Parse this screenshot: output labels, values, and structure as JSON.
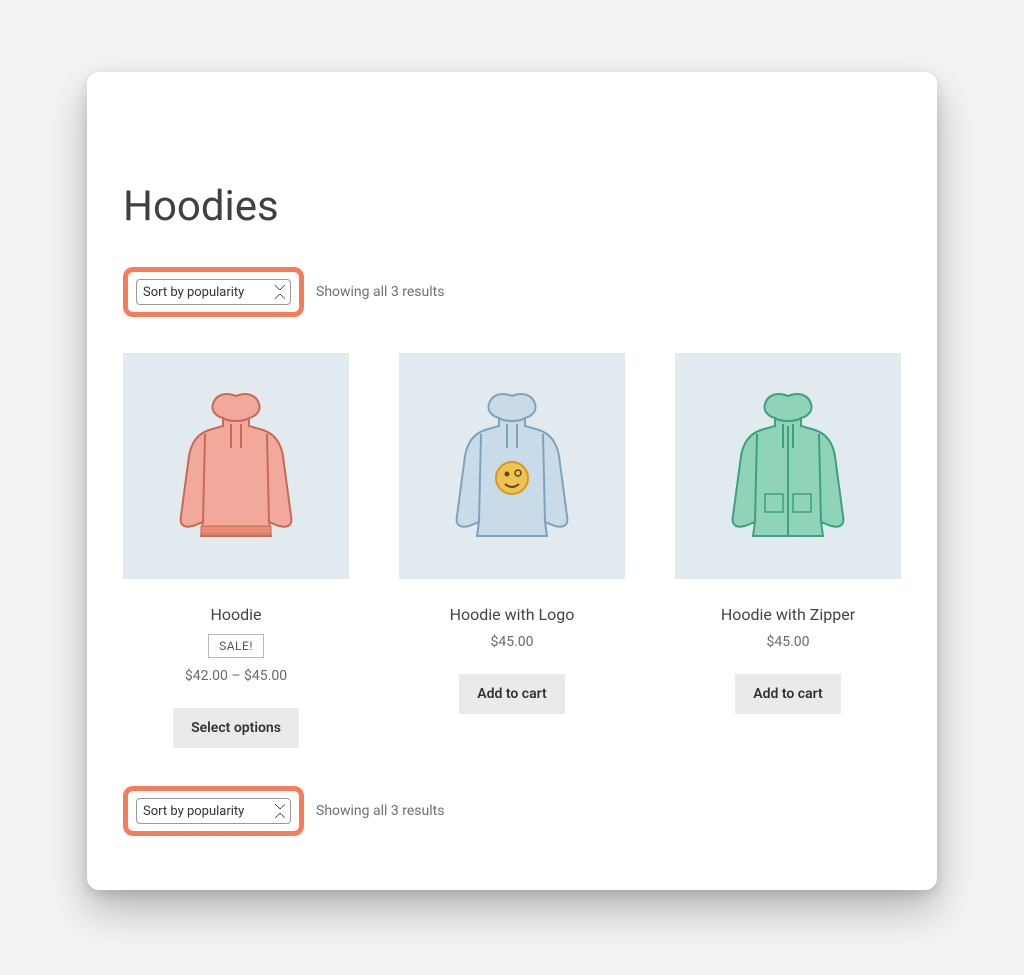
{
  "page_title": "Hoodies",
  "results_text": "Showing all 3 results",
  "sort_label": "Sort by popularity",
  "products": [
    {
      "title": "Hoodie",
      "sale": "SALE!",
      "price": "$42.00 – $45.00",
      "button": "Select options"
    },
    {
      "title": "Hoodie with Logo",
      "sale": "",
      "price": "$45.00",
      "button": "Add to cart"
    },
    {
      "title": "Hoodie with Zipper",
      "sale": "",
      "price": "$45.00",
      "button": "Add to cart"
    }
  ]
}
